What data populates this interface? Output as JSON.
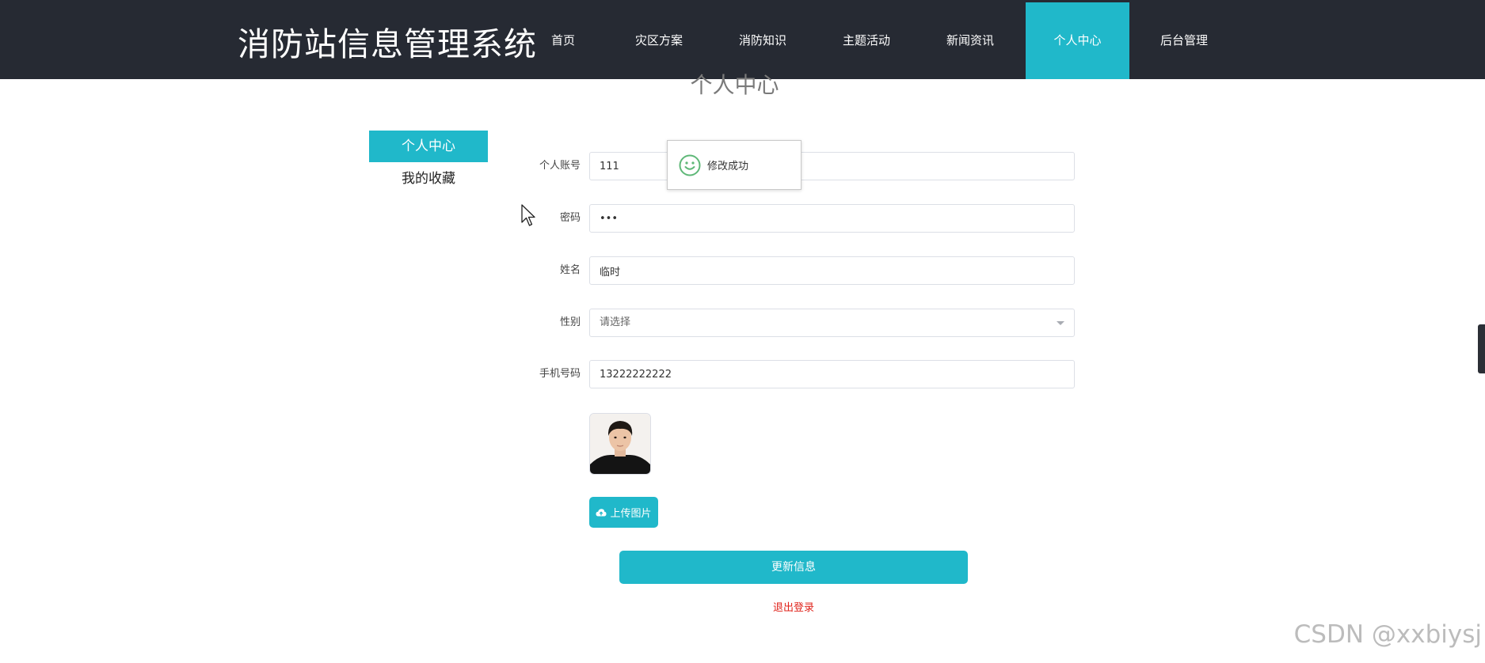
{
  "header": {
    "site_title": "消防站信息管理系统",
    "nav": [
      {
        "label": "首页"
      },
      {
        "label": "灾区方案"
      },
      {
        "label": "消防知识"
      },
      {
        "label": "主题活动"
      },
      {
        "label": "新闻资讯"
      },
      {
        "label": "个人中心",
        "active": true
      },
      {
        "label": "后台管理"
      }
    ]
  },
  "page": {
    "heading": "个人中心"
  },
  "sidebar": {
    "items": [
      {
        "label": "个人中心",
        "active": true
      },
      {
        "label": "我的收藏"
      }
    ]
  },
  "form": {
    "account": {
      "label": "个人账号",
      "value": "111"
    },
    "password": {
      "label": "密码",
      "value": "•••"
    },
    "name": {
      "label": "姓名",
      "value": "临时"
    },
    "gender": {
      "label": "性别",
      "placeholder": "请选择"
    },
    "phone": {
      "label": "手机号码",
      "value": "13222222222"
    },
    "upload_label": "上传图片",
    "submit_label": "更新信息",
    "logout_label": "退出登录"
  },
  "toast": {
    "message": "修改成功",
    "icon": "smile-icon"
  },
  "watermark": "CSDN @xxbiysj",
  "colors": {
    "accent": "#20b8ca",
    "header_bg": "#262a33",
    "logout": "#e0241c"
  }
}
